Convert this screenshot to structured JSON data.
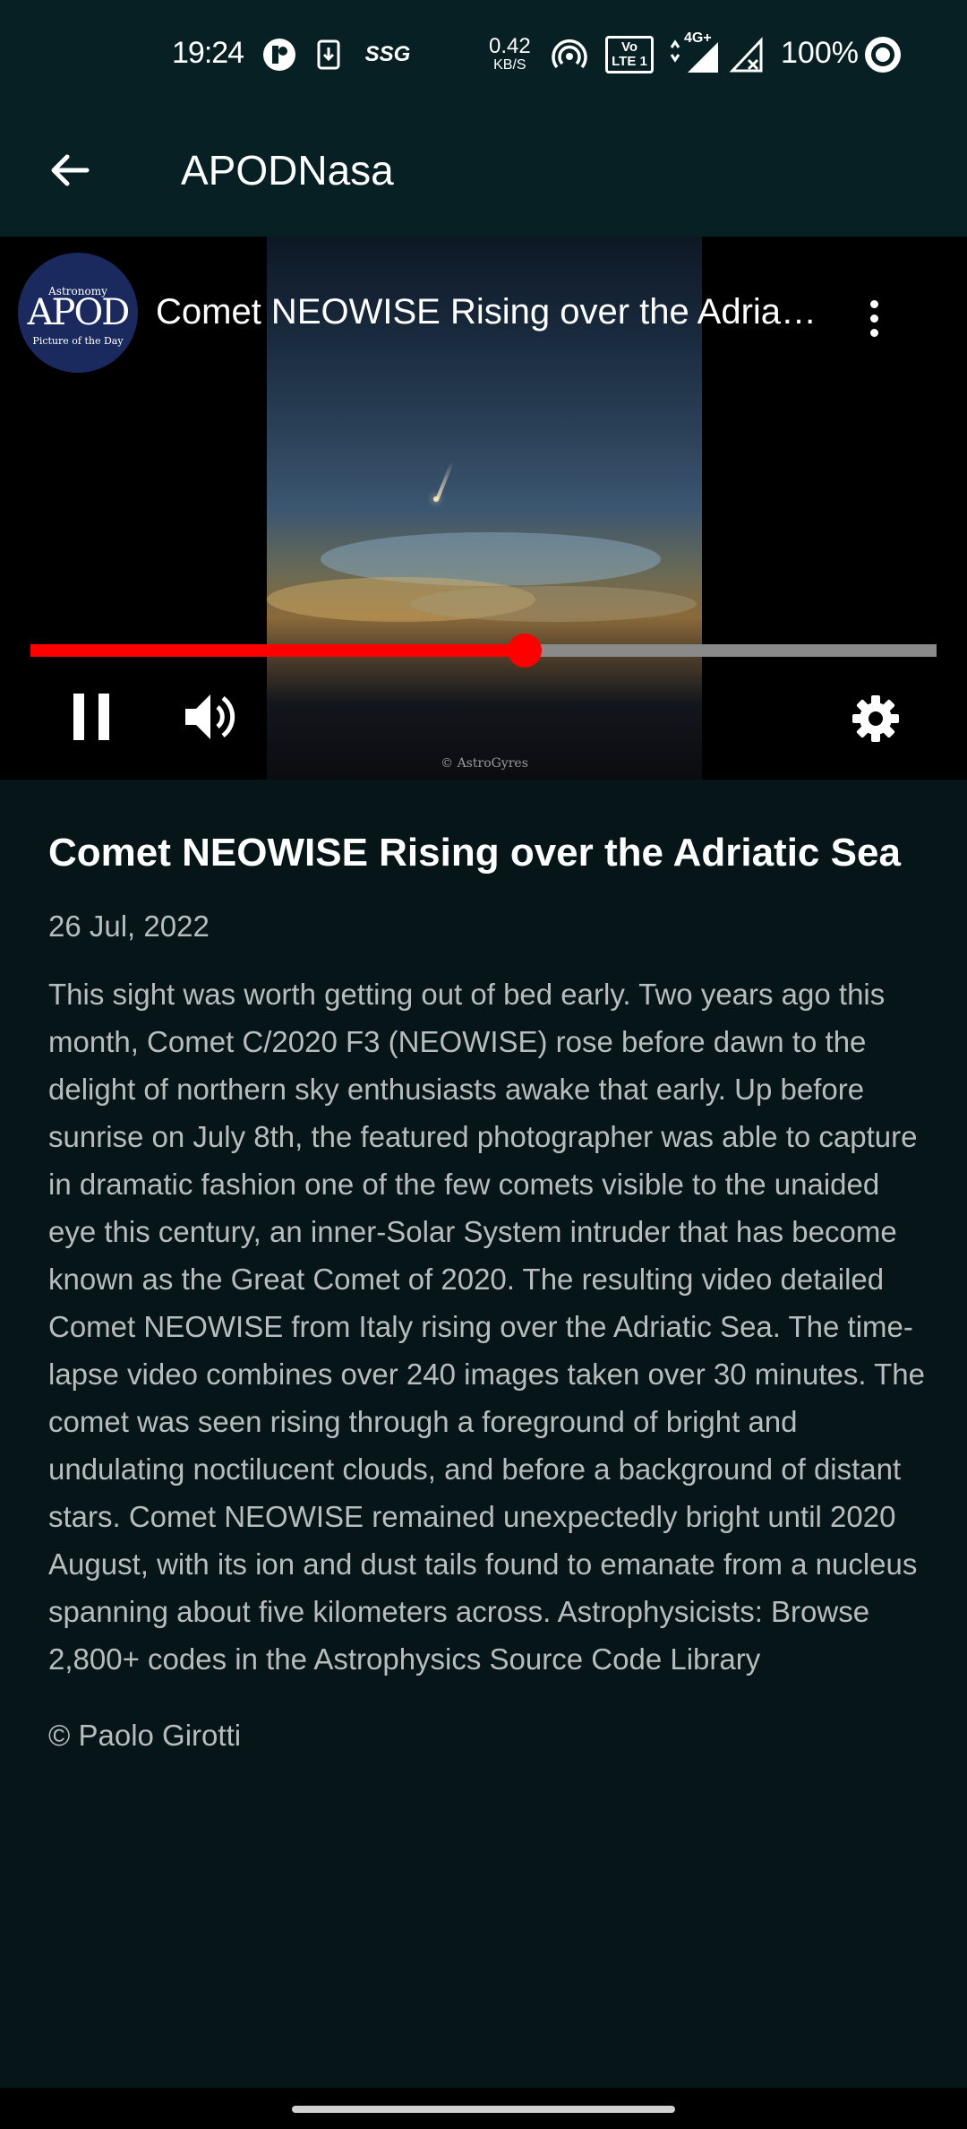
{
  "status_bar": {
    "time": "19:24",
    "net_speed_value": "0.42",
    "net_speed_unit": "KB/S",
    "battery": "100%",
    "icons": [
      "notification-app-icon",
      "download-icon",
      "ssg-icon",
      "hotspot-icon",
      "volte-icon",
      "4g-signal-icon",
      "no-signal-icon",
      "battery-ring-icon"
    ],
    "ssg_label": "SSG",
    "volte_label": "Vo LTE 1",
    "network_label": "4G+"
  },
  "app_bar": {
    "title": "APODNasa",
    "back_icon": "arrow-left-icon"
  },
  "player": {
    "video_title": "Comet NEOWISE Rising over the Adriatic Sea",
    "channel_logo_top": "Astronomy",
    "channel_logo_mid": "APOD",
    "channel_logo_bottom": "Picture of the Day",
    "watermark": "© AstroGyres",
    "progress_fraction": 0.545,
    "colors": {
      "progress_played": "#ff0000",
      "progress_remaining": "#8a8a8a"
    },
    "controls": [
      "pause-icon",
      "volume-icon",
      "settings-icon",
      "more-vertical-icon"
    ]
  },
  "article": {
    "title": "Comet NEOWISE Rising over the Adriatic Sea",
    "date": "26 Jul, 2022",
    "description": "This sight was worth getting out of bed early.  Two years ago this month, Comet C/2020 F3 (NEOWISE) rose before dawn to the delight of northern sky enthusiasts awake that early. Up before sunrise on July 8th, the featured photographer was able to capture in dramatic fashion one of the few comets visible to the unaided eye this century, an inner-Solar System intruder that has become known as the Great Comet of 2020.  The resulting video detailed Comet NEOWISE from Italy rising over the Adriatic Sea. The time-lapse video combines over 240 images taken over 30 minutes.  The comet was seen rising through a foreground of bright and undulating noctilucent clouds, and before a background of distant stars.  Comet NEOWISE remained unexpectedly bright until 2020 August, with its ion and dust tails found to emanate from a nucleus spanning about five kilometers across.    Astrophysicists: Browse 2,800+ codes in the Astrophysics Source Code Library",
    "copyright": "© Paolo Girotti"
  },
  "theme": {
    "background": "#061518",
    "bar_background": "#072024",
    "text_primary": "#ffffff",
    "text_secondary": "#b8bcbd"
  }
}
